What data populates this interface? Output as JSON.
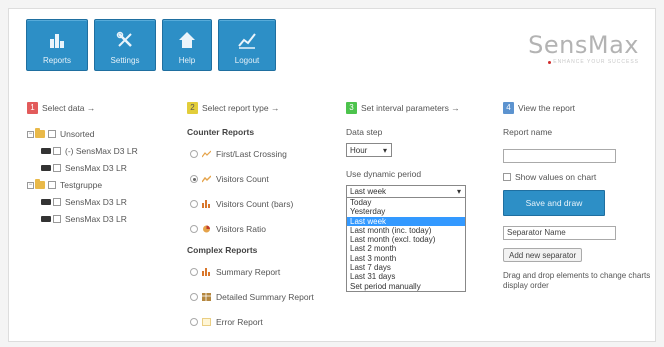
{
  "toolbar": {
    "reports": "Reports",
    "settings": "Settings",
    "help": "Help",
    "logout": "Logout"
  },
  "logo": {
    "name": "SensMax",
    "tagline": "ENHANCE YOUR SUCCESS"
  },
  "colors": {
    "accent": "#2d8fc6",
    "step1": "#e25b5b",
    "step2": "#e2cd3a",
    "step3": "#4cc34c",
    "step4": "#5c93cf",
    "selected": "#3399ff"
  },
  "step1": {
    "num": "1",
    "title": "Select data →",
    "tree": [
      {
        "label": "Unsorted",
        "expander": "−",
        "children": [
          "(-) SensMax D3 LR",
          "SensMax D3 LR"
        ]
      },
      {
        "label": "Testgruppe",
        "expander": "−",
        "children": [
          "SensMax D3 LR",
          "SensMax D3 LR"
        ]
      }
    ]
  },
  "step2": {
    "num": "2",
    "title": "Select report type →",
    "counter_title": "Counter Reports",
    "counter": [
      {
        "label": "First/Last Crossing",
        "checked": false
      },
      {
        "label": "Visitors Count",
        "checked": true
      },
      {
        "label": "Visitors Count (bars)",
        "checked": false
      },
      {
        "label": "Visitors Ratio",
        "checked": false
      }
    ],
    "complex_title": "Complex Reports",
    "complex": [
      {
        "label": "Summary Report",
        "checked": false
      },
      {
        "label": "Detailed Summary Report",
        "checked": false
      },
      {
        "label": "Error Report",
        "checked": false
      }
    ]
  },
  "step3": {
    "num": "3",
    "title": "Set interval parameters →",
    "data_step_label": "Data step",
    "data_step_value": "Hour",
    "period_label": "Use dynamic period",
    "period_value": "Last week",
    "options": [
      "Today",
      "Yesterday",
      "Last week",
      "Last month (inc. today)",
      "Last month (excl. today)",
      "Last 2 month",
      "Last 3 month",
      "Last 7 days",
      "Last 31 days",
      "Set period manually"
    ],
    "selected_index": 2
  },
  "step4": {
    "num": "4",
    "title": "View the report",
    "report_name_label": "Report name",
    "report_name_value": "",
    "show_values": "Show values on chart",
    "save_button": "Save and draw",
    "separator_value": "Separator Name",
    "add_separator": "Add new separator",
    "hint": "Drag and drop elements to change charts display order"
  }
}
